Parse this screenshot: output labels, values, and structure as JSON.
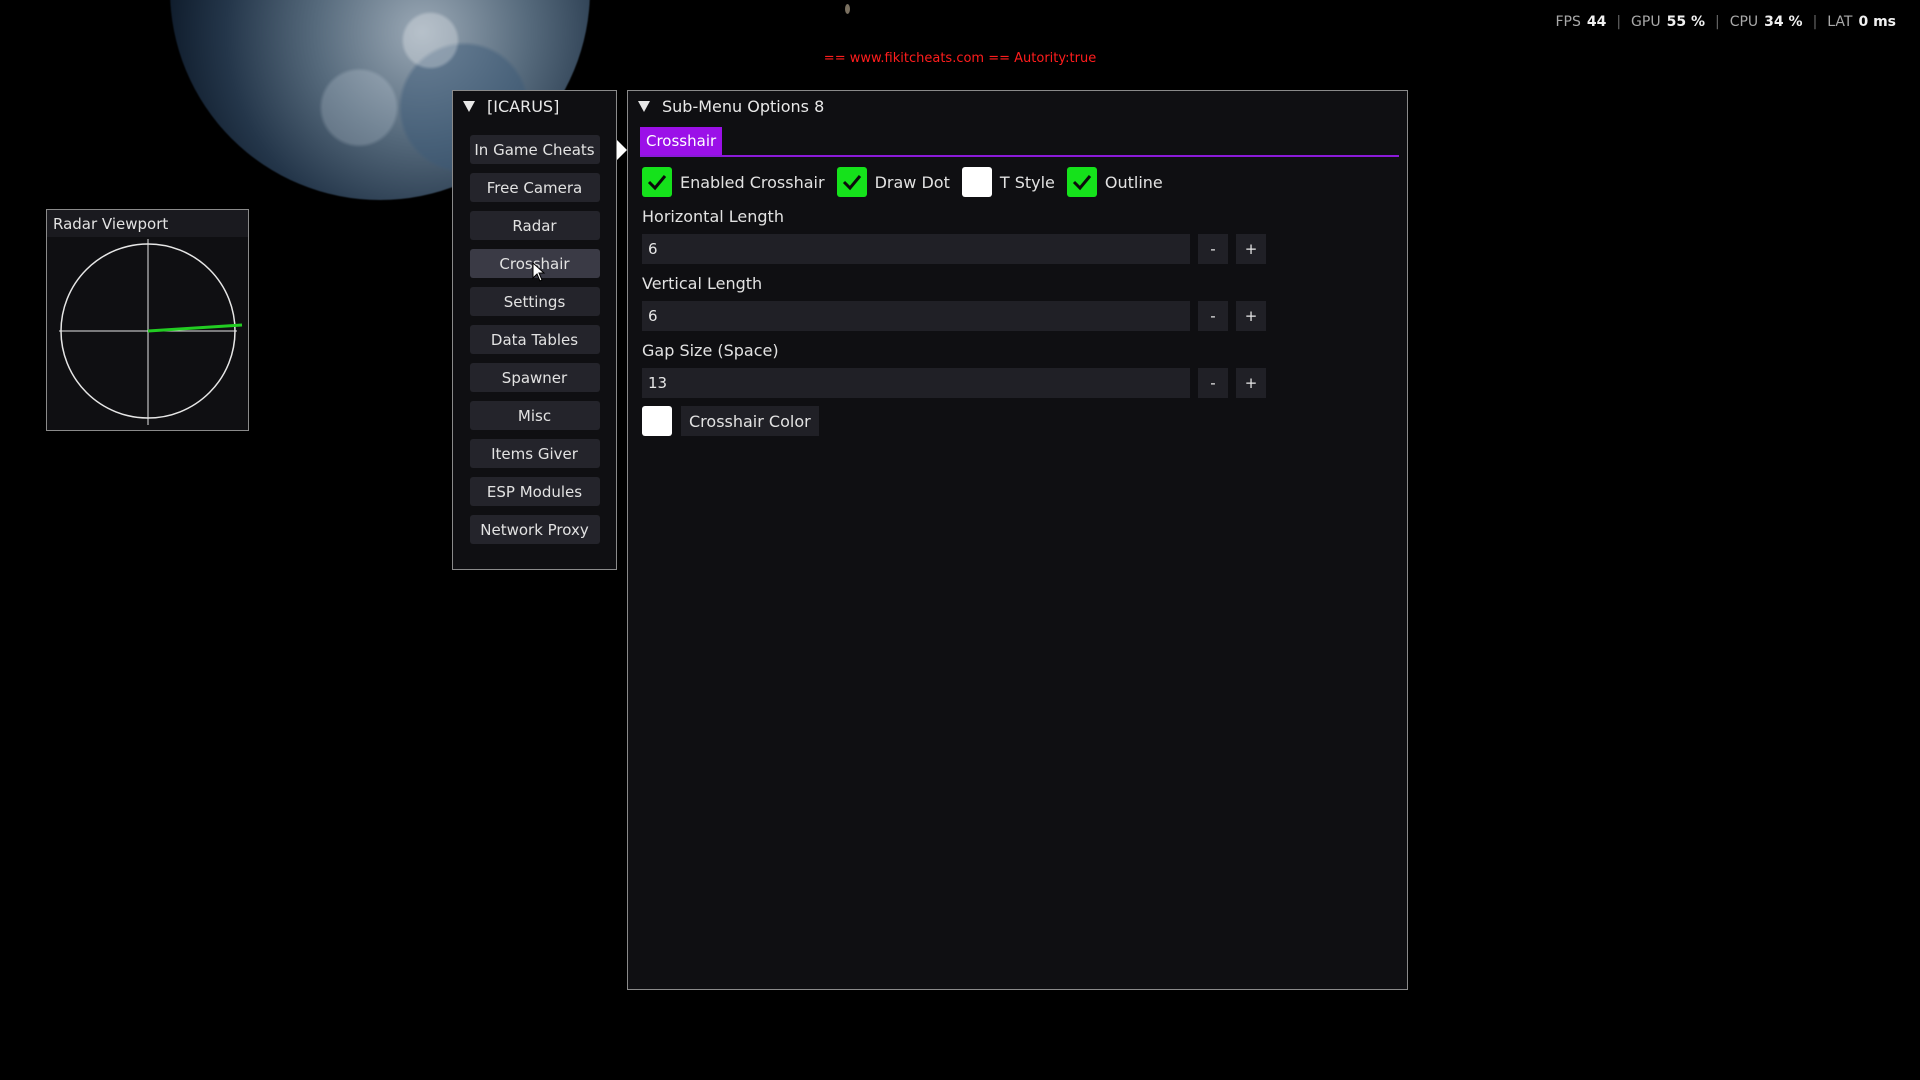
{
  "stats": {
    "fps_label": "FPS",
    "fps_value": "44",
    "gpu_label": "GPU",
    "gpu_value": "55 %",
    "cpu_label": "CPU",
    "cpu_value": "34 %",
    "lat_label": "LAT",
    "lat_value": "0 ms",
    "separator": "|"
  },
  "banner": "== www.fikitcheats.com == Autority:true",
  "radar": {
    "title": "Radar Viewport",
    "line_color": "#22cc22"
  },
  "main_menu": {
    "title": "[ICARUS]",
    "active_index": 3,
    "items": [
      "In Game Cheats",
      "Free Camera",
      "Radar",
      "Crosshair",
      "Settings",
      "Data Tables",
      "Spawner",
      "Misc",
      "Items Giver",
      "ESP Modules",
      "Network Proxy"
    ]
  },
  "submenu": {
    "title": "Sub-Menu Options 8",
    "tab": "Crosshair",
    "accent_color": "#9b10e8",
    "checkboxes": [
      {
        "label": "Enabled Crosshair",
        "checked": true
      },
      {
        "label": "Draw Dot",
        "checked": true
      },
      {
        "label": "T Style",
        "checked": false
      },
      {
        "label": "Outline",
        "checked": true
      }
    ],
    "horizontal": {
      "label": "Horizontal Length",
      "value": "6"
    },
    "vertical": {
      "label": "Vertical Length",
      "value": "6"
    },
    "gap": {
      "label": "Gap Size (Space)",
      "value": "13"
    },
    "minus": "-",
    "plus": "+",
    "color_button": "Crosshair Color",
    "color_value": "#ffffff"
  }
}
